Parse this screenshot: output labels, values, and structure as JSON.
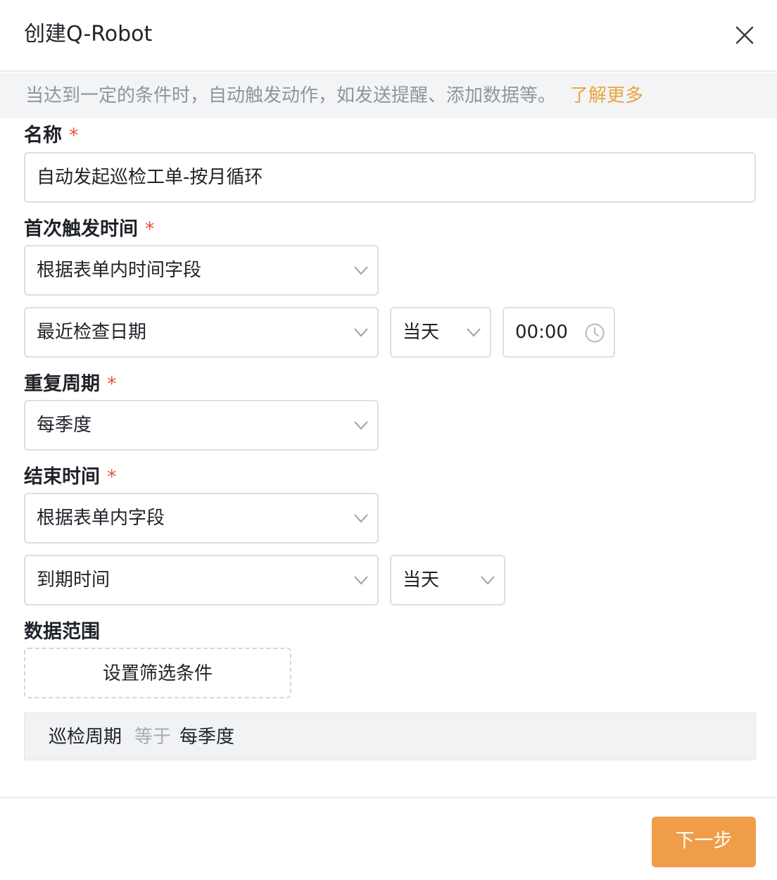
{
  "dialog": {
    "title": "创建Q-Robot",
    "close_icon": "close-icon"
  },
  "notice": {
    "text": "当达到一定的条件时，自动触发动作，如发送提醒、添加数据等。",
    "link": "了解更多"
  },
  "form": {
    "required_mark": "*",
    "name": {
      "label": "名称",
      "value": "自动发起巡检工单-按月循环"
    },
    "first_trigger": {
      "label": "首次触发时间",
      "mode": "根据表单内时间字段",
      "field": "最近检查日期",
      "offset": "当天",
      "time": "00:00"
    },
    "repeat": {
      "label": "重复周期",
      "value": "每季度"
    },
    "end_time": {
      "label": "结束时间",
      "mode": "根据表单内字段",
      "field": "到期时间",
      "offset": "当天"
    },
    "data_range": {
      "label": "数据范围",
      "button": "设置筛选条件",
      "condition": {
        "field": "巡检周期",
        "operator": "等于",
        "value": "每季度"
      }
    }
  },
  "footer": {
    "next_label": "下一步"
  },
  "colors": {
    "accent": "#ef9d48",
    "link": "#e9a53c",
    "required": "#e9543c",
    "notice_bg": "#f3f4f6"
  }
}
